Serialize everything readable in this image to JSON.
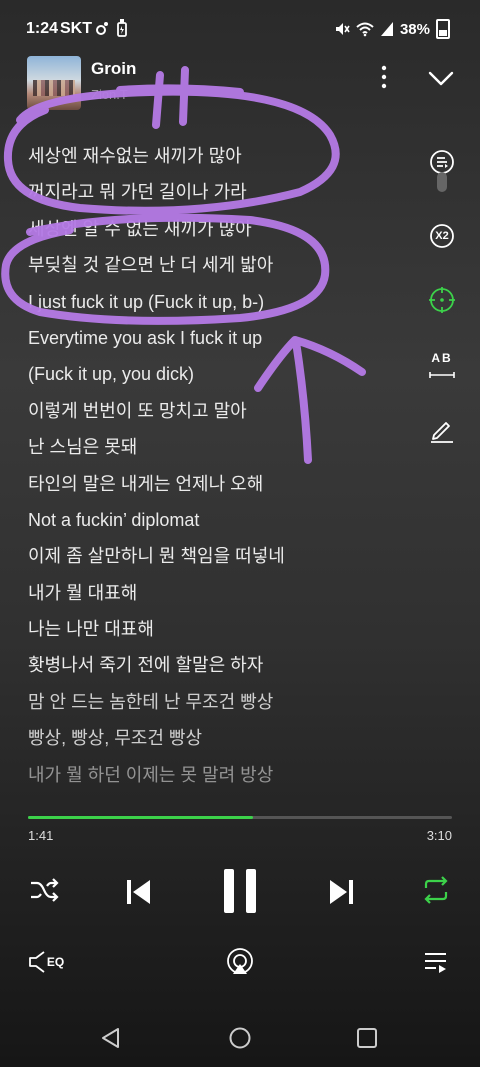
{
  "status_bar": {
    "time": "1:24",
    "carrier": "SKT",
    "battery_percent": "38%",
    "icons": [
      "bluetooth-icon",
      "usb-icon",
      "mute-icon",
      "wifi-icon",
      "signal-icon",
      "battery-icon"
    ]
  },
  "now_playing": {
    "title": "Groin",
    "artist": "Zion.T",
    "colors": {
      "accent": "#3cd24a",
      "annotation": "#b57ae6"
    }
  },
  "lyrics": [
    "세상엔 재수없는 새끼가 많아",
    "꺼지라고 뭐 가던 길이나 가라",
    "세상엔 알 수 없는 새끼가 많아",
    "부딪칠 것 같으면 난 더 세게 밟아",
    "I just fuck it up (Fuck it up, b-)",
    "Everytime you ask I fuck it up",
    "(Fuck it up, you dick)",
    "이렇게 번번이 또 망치고 말아",
    "난 스님은 못돼",
    "타인의 말은 내게는 언제나 오해",
    "Not a fuckin’ diplomat",
    "이제 좀 살만하니 뭔 책임을 떠넣네",
    "내가 뭘 대표해",
    "나는 나만 대표해",
    "홧병나서 죽기 전에 할말은 하자",
    "맘 안 드는 놈한테 난 무조건 빵상",
    "빵상, 빵상, 무조건 빵상",
    "내가 뭘 하던 이제는 못 말려 방상"
  ],
  "side_tools": {
    "x2_label": "X2",
    "ab_label": "AB"
  },
  "playback": {
    "elapsed": "1:41",
    "total": "3:10",
    "progress": 0.531
  },
  "bottom_bar": {
    "eq_label": "EQ"
  }
}
